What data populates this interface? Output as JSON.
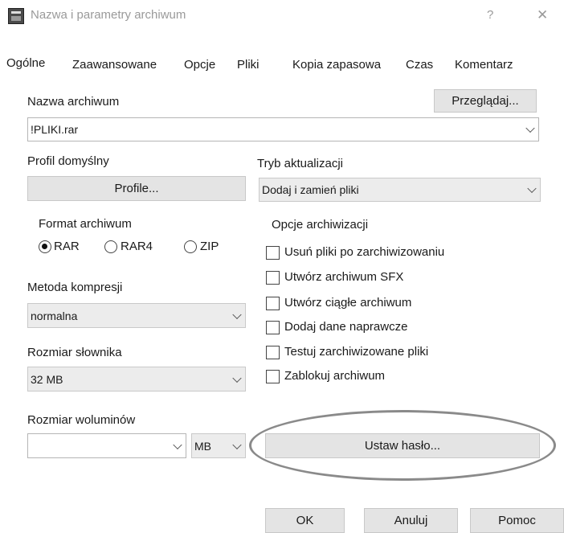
{
  "window": {
    "title": "Nazwa i parametry archiwum",
    "help": "?",
    "close": "✕"
  },
  "tabs": [
    "Ogólne",
    "Zaawansowane",
    "Opcje",
    "Pliki",
    "Kopia zapasowa",
    "Czas",
    "Komentarz"
  ],
  "archive_name": {
    "label": "Nazwa archiwum",
    "browse": "Przeglądaj...",
    "value": "!PLIKI.rar"
  },
  "profile": {
    "label": "Profil domyślny",
    "button": "Profile..."
  },
  "update_mode": {
    "label": "Tryb aktualizacji",
    "value": "Dodaj i zamień pliki"
  },
  "format": {
    "label": "Format archiwum",
    "options": [
      "RAR",
      "RAR4",
      "ZIP"
    ],
    "selected": "RAR"
  },
  "compression": {
    "label": "Metoda kompresji",
    "value": "normalna"
  },
  "dictionary": {
    "label": "Rozmiar słownika",
    "value": "32 MB"
  },
  "volumes": {
    "label": "Rozmiar woluminów",
    "value": "",
    "unit": "MB"
  },
  "archive_options": {
    "label": "Opcje archiwizacji",
    "items": [
      "Usuń pliki po zarchiwizowaniu",
      "Utwórz archiwum SFX",
      "Utwórz ciągłe archiwum",
      "Dodaj dane naprawcze",
      "Testuj zarchiwizowane pliki",
      "Zablokuj archiwum"
    ]
  },
  "set_password": "Ustaw hasło...",
  "footer": {
    "ok": "OK",
    "cancel": "Anuluj",
    "help": "Pomoc"
  }
}
